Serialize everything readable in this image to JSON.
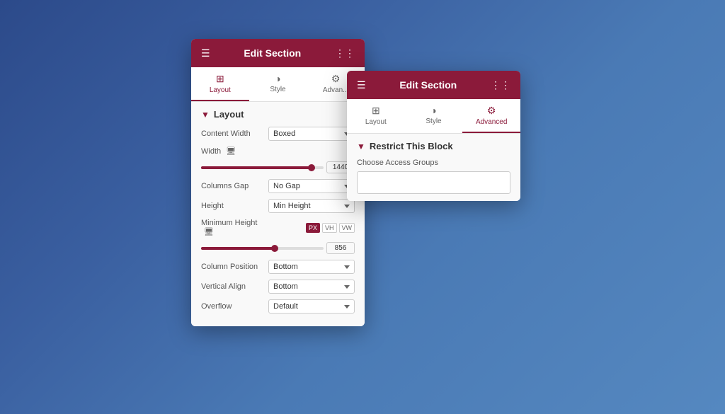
{
  "panel1": {
    "header": {
      "title": "Edit Section",
      "hamburger_label": "☰",
      "grid_label": "⋮⋮"
    },
    "tabs": [
      {
        "id": "layout",
        "icon": "⊞",
        "label": "Layout",
        "active": true
      },
      {
        "id": "style",
        "icon": "◑",
        "label": "Style",
        "active": false
      },
      {
        "id": "advanced",
        "icon": "⚙",
        "label": "Advan...",
        "active": false
      }
    ],
    "section": {
      "title": "Layout",
      "fields": [
        {
          "label": "Content Width",
          "type": "select",
          "value": "Boxed"
        },
        {
          "label": "Width",
          "type": "slider",
          "value": "1440",
          "has_monitor": true
        },
        {
          "label": "Columns Gap",
          "type": "select",
          "value": "No Gap"
        },
        {
          "label": "Height",
          "type": "select",
          "value": "Min Height"
        },
        {
          "label": "Minimum Height",
          "type": "slider_units",
          "value": "856",
          "units": [
            "PX",
            "VH",
            "VW"
          ],
          "has_monitor": true
        },
        {
          "label": "Column Position",
          "type": "select",
          "value": "Bottom"
        },
        {
          "label": "Vertical Align",
          "type": "select",
          "value": "Bottom"
        },
        {
          "label": "Overflow",
          "type": "select",
          "value": "Default"
        }
      ]
    }
  },
  "panel2": {
    "header": {
      "title": "Edit Section",
      "hamburger_label": "☰",
      "grid_label": "⋮⋮"
    },
    "tabs": [
      {
        "id": "layout",
        "icon": "⊞",
        "label": "Layout",
        "active": false
      },
      {
        "id": "style",
        "icon": "◑",
        "label": "Style",
        "active": false
      },
      {
        "id": "advanced",
        "icon": "⚙",
        "label": "Advanced",
        "active": true
      }
    ],
    "section": {
      "title": "Restrict This Block",
      "choose_label": "Choose Access Groups",
      "access_placeholder": ""
    }
  }
}
